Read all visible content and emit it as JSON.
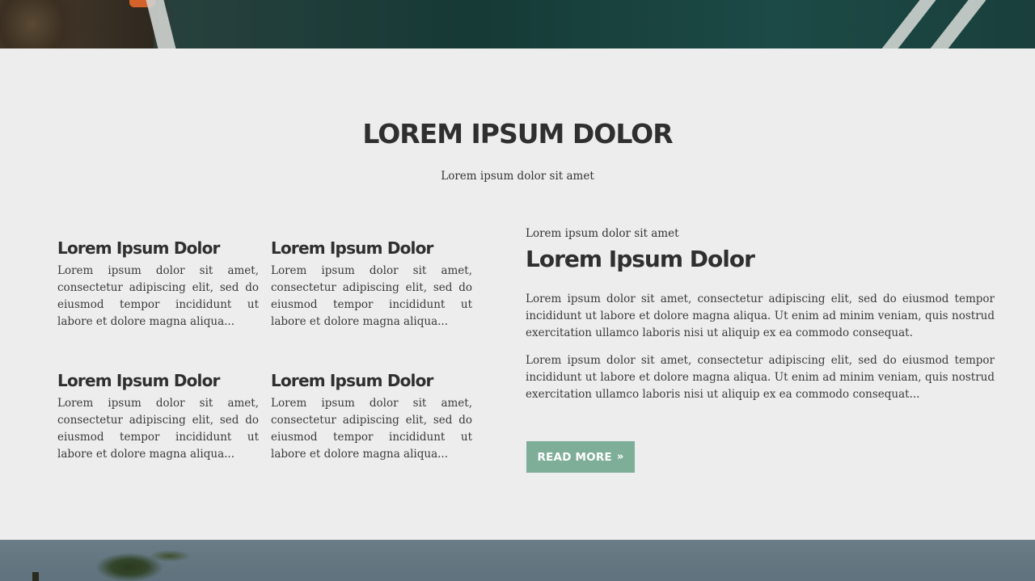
{
  "section": {
    "title": "LOREM IPSUM DOLOR",
    "subtitle": "Lorem ipsum dolor sit amet"
  },
  "features": [
    {
      "title": "Lorem Ipsum Dolor",
      "text": "Lorem ipsum dolor sit amet, consectetur adipiscing elit, sed do eiusmod tempor incididunt ut labore et dolore magna aliqua..."
    },
    {
      "title": "Lorem Ipsum Dolor",
      "text": "Lorem ipsum dolor sit amet, consectetur adipiscing elit, sed do eiusmod tempor incididunt ut labore et dolore magna aliqua..."
    },
    {
      "title": "Lorem Ipsum Dolor",
      "text": "Lorem ipsum dolor sit amet, consectetur adipiscing elit, sed do eiusmod tempor incididunt ut labore et dolore magna aliqua..."
    },
    {
      "title": "Lorem Ipsum Dolor",
      "text": "Lorem ipsum dolor sit amet, consectetur adipiscing elit, sed do eiusmod tempor incididunt ut labore et dolore magna aliqua..."
    }
  ],
  "side": {
    "kicker": "Lorem ipsum dolor sit amet",
    "title": "Lorem Ipsum Dolor",
    "paragraph_1": "Lorem ipsum dolor sit amet, consectetur adipiscing elit, sed do eiusmod tempor incididunt ut labore et dolore magna aliqua. Ut enim ad minim veniam, quis nostrud exercitation ullamco laboris nisi ut aliquip ex ea commodo consequat.",
    "paragraph_2": "Lorem ipsum dolor sit amet, consectetur adipiscing elit, sed do eiusmod tempor incididunt ut labore et dolore magna aliqua. Ut enim ad minim veniam, quis nostrud exercitation ullamco laboris nisi ut aliquip ex ea commodo consequat...",
    "button_label": "READ MORE",
    "button_arrows": "»"
  },
  "colors": {
    "background": "#ededed",
    "button": "#7fae98",
    "heading": "#2f2f2f"
  }
}
